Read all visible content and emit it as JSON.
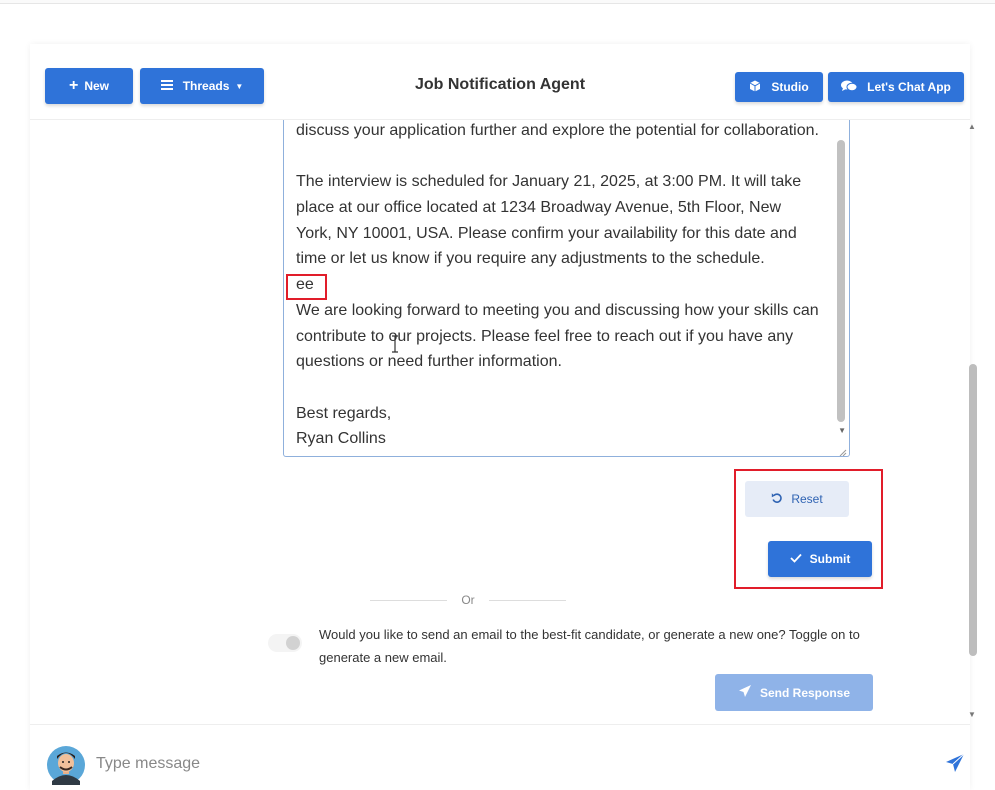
{
  "header": {
    "new_label": "New",
    "threads_label": "Threads",
    "title": "Job Notification Agent",
    "studio_label": "Studio",
    "chat_label": "Let's Chat App"
  },
  "email": {
    "lines": [
      "discuss your application further and explore the potential for collaboration.",
      "",
      "The interview is scheduled for January 21, 2025, at 3:00 PM. It will take",
      "place at our office located at 1234 Broadway Avenue, 5th Floor, New",
      "York, NY 10001, USA. Please confirm your availability for this date and",
      "time or let us know if you require any adjustments to the schedule.",
      "ee",
      "We are looking forward to meeting you and discussing how your skills can",
      "contribute to our projects. Please feel free to reach out if you have any",
      "questions or need further information.",
      "",
      "Best regards,",
      "Ryan Collins"
    ]
  },
  "actions": {
    "reset_label": "Reset",
    "submit_label": "Submit",
    "or_label": "Or",
    "toggle_text": "Would you like to send an email to the best-fit candidate, or generate a new one? Toggle on to generate a new email.",
    "toggle_on": false,
    "send_response_label": "Send Response"
  },
  "footer": {
    "placeholder": "Type message"
  },
  "colors": {
    "primary": "#2f73d9",
    "highlight": "#e11d2a",
    "disabled": "#8fb3e8"
  }
}
